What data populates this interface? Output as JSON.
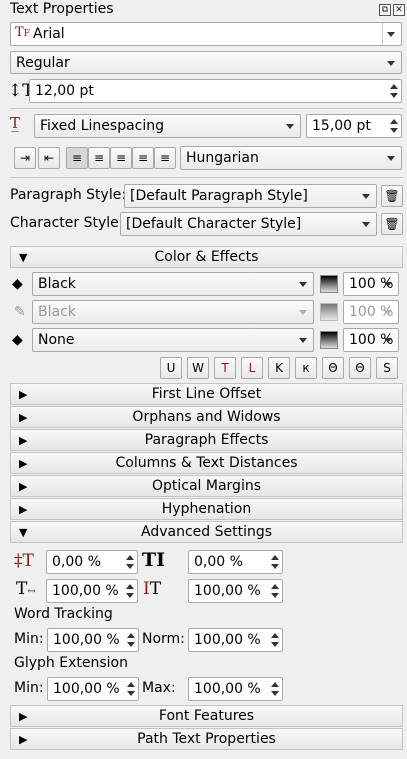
{
  "panel": {
    "title": "Text Properties",
    "float_button": "⧉",
    "close_button": "✕"
  },
  "font": {
    "family": "Arial",
    "style": "Regular",
    "size": "12,00 pt"
  },
  "linespacing": {
    "mode": "Fixed Linespacing",
    "value": "15,00 pt"
  },
  "language": "Hungarian",
  "paragraph_style": {
    "label": "Paragraph Style:",
    "value": "[Default Paragraph Style]"
  },
  "character_style": {
    "label": "Character Style:",
    "value": "[Default Character Style]"
  },
  "sections": {
    "color_effects": "Color & Effects",
    "first_line_offset": "First Line Offset",
    "orphans_widows": "Orphans and Widows",
    "paragraph_effects": "Paragraph Effects",
    "columns": "Columns & Text Distances",
    "optical_margins": "Optical Margins",
    "hyphenation": "Hyphenation",
    "advanced": "Advanced Settings",
    "font_features": "Font Features",
    "path_text": "Path Text Properties"
  },
  "color": {
    "fill": {
      "name": "Black",
      "shade": "100 %"
    },
    "stroke": {
      "name": "Black",
      "shade": "100 %"
    },
    "background": {
      "name": "None",
      "shade": "100 %"
    }
  },
  "effects_buttons": [
    "U",
    "W",
    "T",
    "L",
    "K",
    "к",
    "Θ",
    "Θ",
    "S"
  ],
  "advanced": {
    "baseline_offset": "0,00 %",
    "tracking": "0,00 %",
    "horizontal_scale": "100,00 %",
    "vertical_scale": "100,00 %",
    "word_tracking_label": "Word Tracking",
    "wt_min_label": "Min:",
    "wt_min": "100,00 %",
    "wt_norm_label": "Norm:",
    "wt_norm": "100,00 %",
    "glyph_extension_label": "Glyph Extension",
    "ge_min_label": "Min:",
    "ge_min": "100,00 %",
    "ge_max_label": "Max:",
    "ge_max": "100,00 %"
  },
  "accent_color": "#8b1a1a"
}
